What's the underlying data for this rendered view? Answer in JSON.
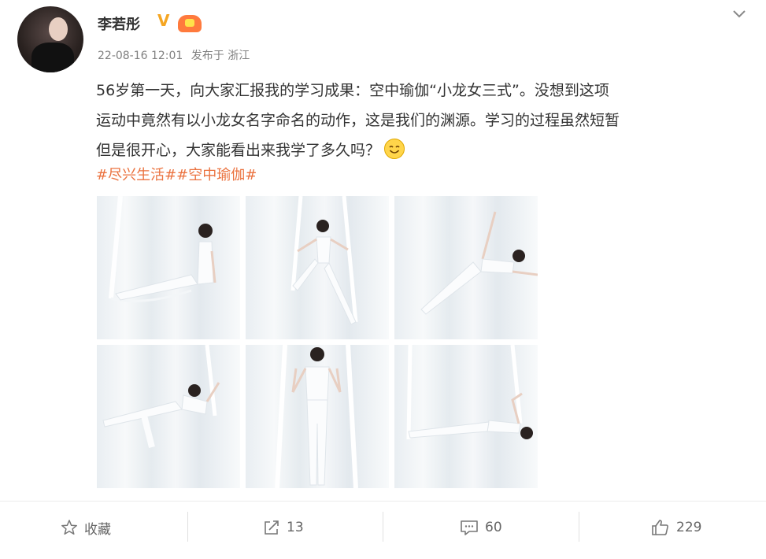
{
  "author": {
    "name": "李若彤",
    "verified_mark": "V"
  },
  "post": {
    "date": "22-08-16 12:01",
    "published_from": "发布于 浙江",
    "lines": [
      "56岁第一天，向大家汇报我的学习成果：空中瑜伽“小龙女三式”。没想到这项",
      "运动中竟然有以小龙女名字命名的动作，这是我们的渊源。学习的过程虽然短暂",
      "但是很开心，大家能看出来我学了多久吗？"
    ],
    "tags": [
      "#尽兴生活#",
      "#空中瑜伽#"
    ],
    "photos_count": 6
  },
  "actions": {
    "favorite_label": "收藏",
    "repost_count": "13",
    "comment_count": "60",
    "like_count": "229"
  },
  "icons": {
    "verified": "verified-v-icon",
    "vip": "vip-badge-icon",
    "menu": "chevron-down-icon",
    "emoji": "smiley-emoji-icon",
    "favorite": "star-icon",
    "repost": "repost-icon",
    "comment": "comment-icon",
    "like": "thumbs-up-icon"
  },
  "colors": {
    "tag": "#eb7340",
    "verified": "#f5a623",
    "meta": "#808080"
  }
}
